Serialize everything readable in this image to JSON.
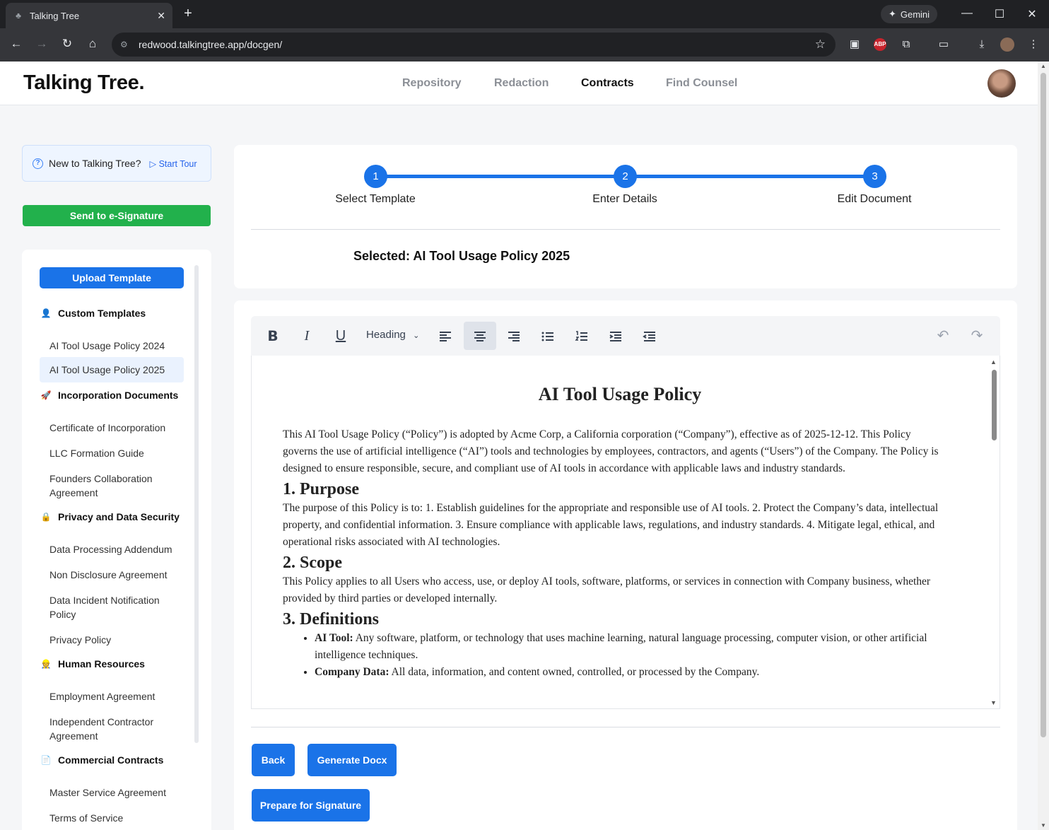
{
  "browser": {
    "tab_title": "Talking Tree",
    "url": "redwood.talkingtree.app/docgen/",
    "gemini_label": "Gemini",
    "abp_label": "ABP"
  },
  "app": {
    "logo": "Talking Tree.",
    "nav": [
      "Repository",
      "Redaction",
      "Contracts",
      "Find Counsel"
    ],
    "active_nav": "Contracts"
  },
  "sidebar": {
    "tour_text": "New to Talking Tree?",
    "tour_link": "Start Tour",
    "esign_button": "Send to e-Signature",
    "upload_button": "Upload Template",
    "categories": [
      {
        "title": "Custom Templates",
        "items": [
          "AI Tool Usage Policy 2024",
          "AI Tool Usage Policy 2025"
        ]
      },
      {
        "title": "Incorporation Documents",
        "items": [
          "Certificate of Incorporation",
          "LLC Formation Guide",
          "Founders Collaboration Agreement"
        ]
      },
      {
        "title": "Privacy and Data Security",
        "items": [
          "Data Processing Addendum",
          "Non Disclosure Agreement",
          "Data Incident Notification Policy",
          "Privacy Policy"
        ]
      },
      {
        "title": "Human Resources",
        "items": [
          "Employment Agreement",
          "Independent Contractor Agreement"
        ]
      },
      {
        "title": "Commercial Contracts",
        "items": [
          "Master Service Agreement",
          "Terms of Service"
        ]
      }
    ],
    "selected_item": "AI Tool Usage Policy 2025"
  },
  "stepper": {
    "steps": [
      {
        "num": "1",
        "label": "Select Template"
      },
      {
        "num": "2",
        "label": "Enter Details"
      },
      {
        "num": "3",
        "label": "Edit Document"
      }
    ],
    "selected_text": "Selected: AI Tool Usage Policy 2025"
  },
  "editor": {
    "heading_select": "Heading",
    "doc": {
      "title": "AI Tool Usage Policy",
      "intro": "This AI Tool Usage Policy (“Policy”) is adopted by Acme Corp, a California corporation (“Company”), effective as of 2025-12-12. This Policy governs the use of artificial intelligence (“AI”) tools and technologies by employees, contractors, and agents (“Users”) of the Company. The Policy is designed to ensure responsible, secure, and compliant use of AI tools in accordance with applicable laws and industry standards.",
      "s1_title": "1. Purpose",
      "s1_body": "The purpose of this Policy is to: 1. Establish guidelines for the appropriate and responsible use of AI tools. 2. Protect the Company’s data, intellectual property, and confidential information. 3. Ensure compliance with applicable laws, regulations, and industry standards. 4. Mitigate legal, ethical, and operational risks associated with AI technologies.",
      "s2_title": "2. Scope",
      "s2_body": "This Policy applies to all Users who access, use, or deploy AI tools, software, platforms, or services in connection with Company business, whether provided by third parties or developed internally.",
      "s3_title": "3. Definitions",
      "defs": [
        {
          "term": "AI Tool:",
          "text": " Any software, platform, or technology that uses machine learning, natural language processing, computer vision, or other artificial intelligence techniques."
        },
        {
          "term": "Company Data:",
          "text": " All data, information, and content owned, controlled, or processed by the Company."
        }
      ]
    },
    "back_button": "Back",
    "generate_button": "Generate Docx",
    "prepare_button": "Prepare for Signature"
  }
}
